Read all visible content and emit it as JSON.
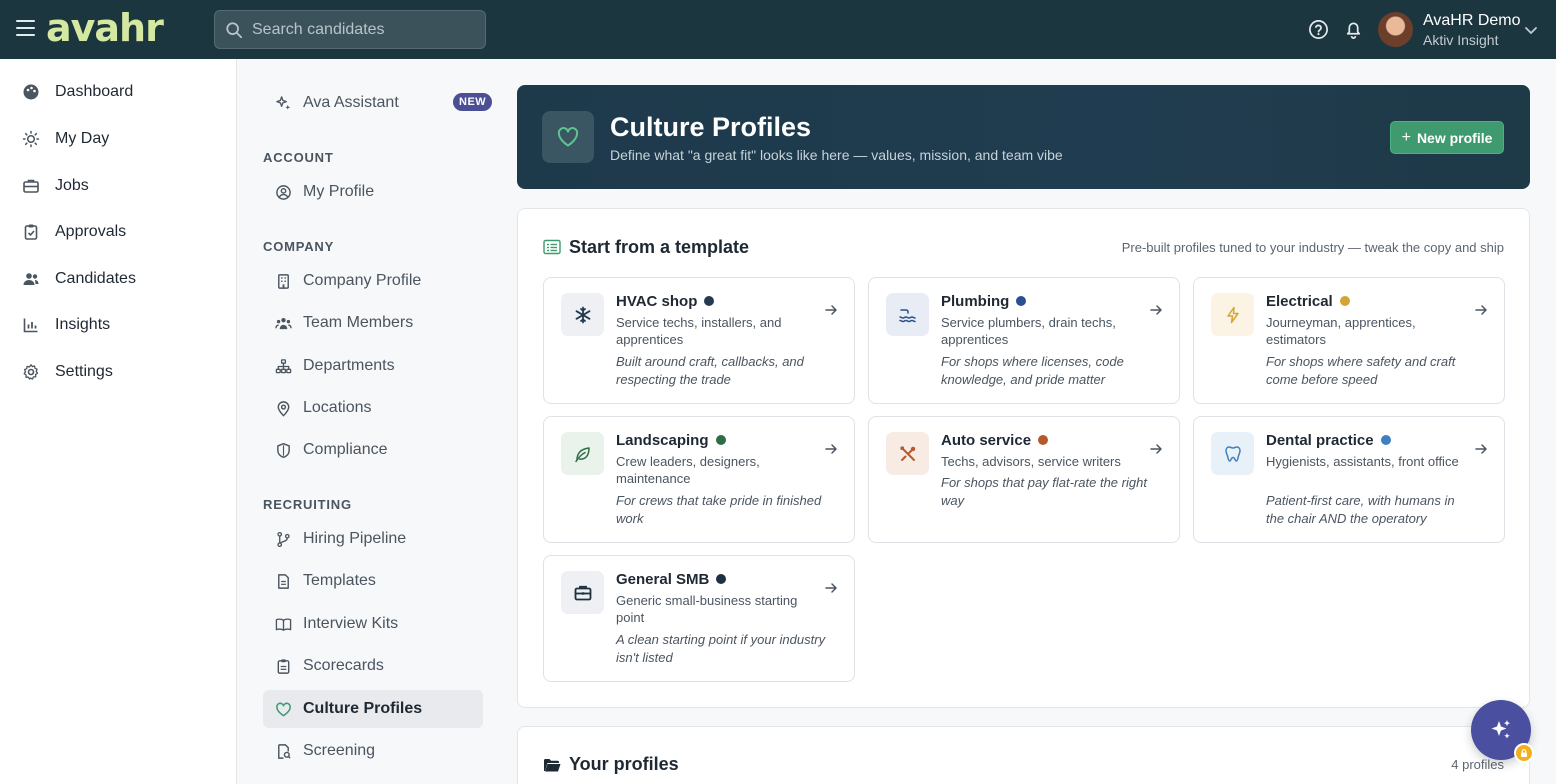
{
  "topbar": {
    "logo": "avahr",
    "search_placeholder": "Search candidates",
    "user_name": "AvaHR Demo",
    "user_org": "Aktiv Insight"
  },
  "leftnav": {
    "items": [
      {
        "label": "Dashboard",
        "icon": "palette-icon"
      },
      {
        "label": "My Day",
        "icon": "sun-icon"
      },
      {
        "label": "Jobs",
        "icon": "briefcase-icon"
      },
      {
        "label": "Approvals",
        "icon": "clipboard-check-icon"
      },
      {
        "label": "Candidates",
        "icon": "users-icon"
      },
      {
        "label": "Insights",
        "icon": "bar-chart-icon"
      },
      {
        "label": "Settings",
        "icon": "gear-icon"
      }
    ]
  },
  "subnav": {
    "assistant_label": "Ava Assistant",
    "assistant_badge": "NEW",
    "account_head": "ACCOUNT",
    "my_profile": "My Profile",
    "company_head": "COMPANY",
    "company_items": [
      "Company Profile",
      "Team Members",
      "Departments",
      "Locations",
      "Compliance"
    ],
    "recruiting_head": "RECRUITING",
    "recruiting_items": [
      "Hiring Pipeline",
      "Templates",
      "Interview Kits",
      "Scorecards",
      "Culture Profiles",
      "Screening"
    ]
  },
  "hero": {
    "title": "Culture Profiles",
    "subtitle": "Define what \"a great fit\" looks like here — values, mission, and team vibe",
    "button_label": "New profile",
    "accent": "#3f9a6f"
  },
  "templates": {
    "title": "Start from a template",
    "note": "Pre-built profiles tuned to your industry — tweak the copy and ship",
    "cards": [
      {
        "title": "HVAC shop",
        "dot": "#243a52",
        "desc": "Service techs, installers, and apprentices",
        "tagline": "Built around craft, callbacks, and respecting the trade",
        "icon": "snowflake-icon"
      },
      {
        "title": "Plumbing",
        "dot": "#2b4f8f",
        "desc": "Service plumbers, drain techs, apprentices",
        "tagline": "For shops where licenses, code knowledge, and pride matter",
        "icon": "water-icon"
      },
      {
        "title": "Electrical",
        "dot": "#d4a534",
        "desc": "Journeyman, apprentices, estimators",
        "tagline": "For shops where safety and craft come before speed",
        "icon": "bolt-icon"
      },
      {
        "title": "Landscaping",
        "dot": "#2f6e44",
        "desc": "Crew leaders, designers, maintenance",
        "tagline": "For crews that take pride in finished work",
        "icon": "leaf-icon"
      },
      {
        "title": "Auto service",
        "dot": "#b55a2c",
        "desc": "Techs, advisors, service writers",
        "tagline": "For shops that pay flat-rate the right way",
        "icon": "tools-icon"
      },
      {
        "title": "Dental practice",
        "dot": "#3f7fbf",
        "desc": "Hygienists, assistants, front office",
        "tagline": "Patient-first care, with humans in the chair AND the operatory",
        "icon": "tooth-icon"
      },
      {
        "title": "General SMB",
        "dot": "#1f3040",
        "desc": "Generic small-business starting point",
        "tagline": "A clean starting point if your industry isn't listed",
        "icon": "briefcase-icon"
      }
    ]
  },
  "your_profiles": {
    "title": "Your profiles",
    "count": "4 profiles"
  }
}
